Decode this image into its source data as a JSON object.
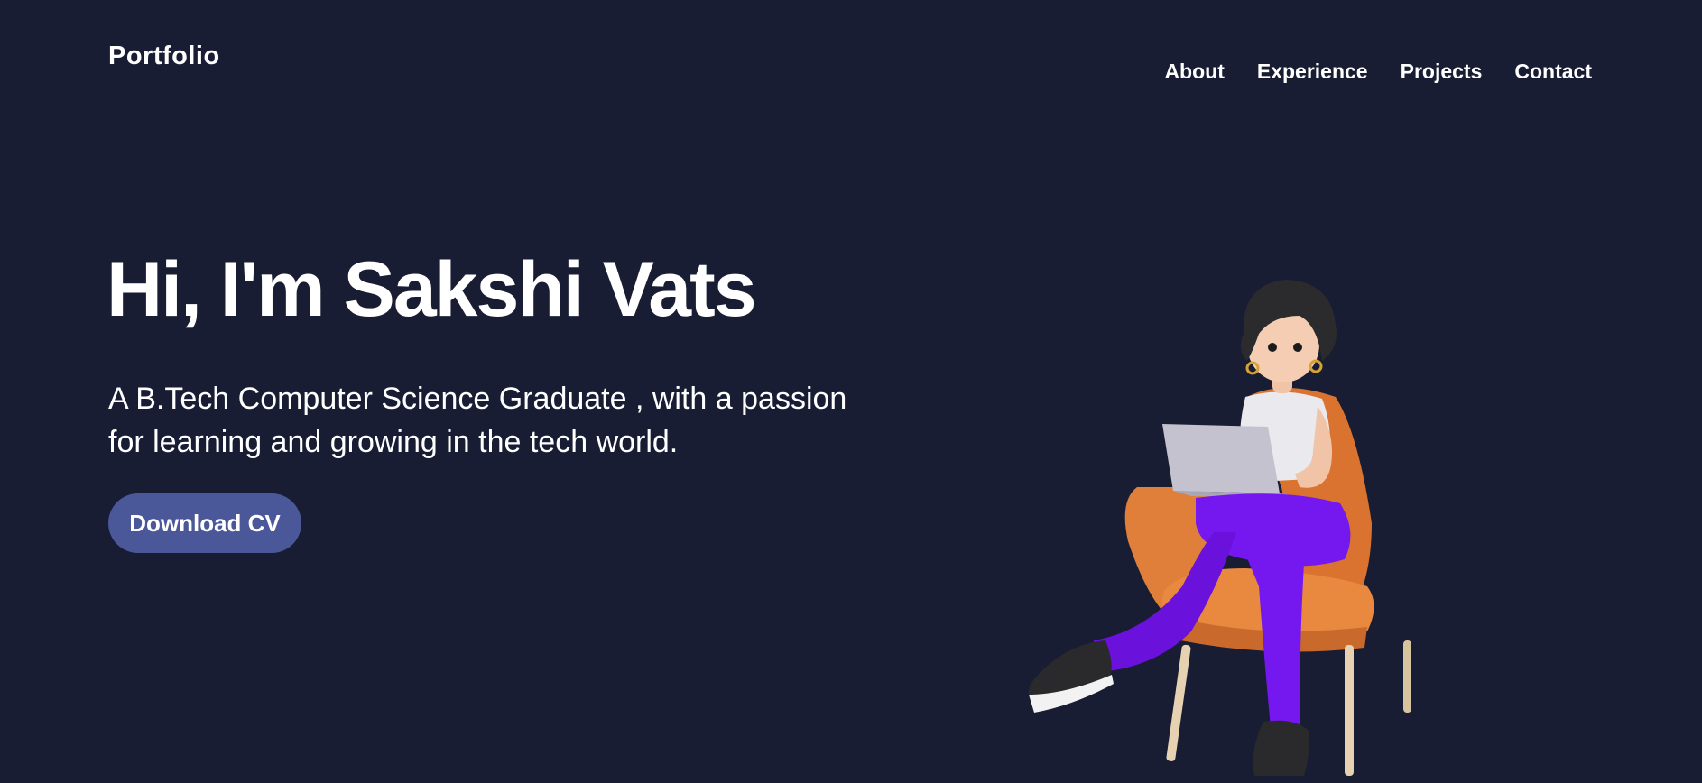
{
  "header": {
    "brand": "Portfolio",
    "nav": [
      {
        "label": "About"
      },
      {
        "label": "Experience"
      },
      {
        "label": "Projects"
      },
      {
        "label": "Contact"
      }
    ]
  },
  "hero": {
    "title": "Hi, I'm Sakshi Vats",
    "subtitle": "A B.Tech Computer Science Graduate , with a passion for learning and growing in the tech world.",
    "cta_label": "Download CV",
    "illustration": "woman-with-laptop-in-armchair"
  },
  "colors": {
    "background": "#181d33",
    "text": "#ffffff",
    "button": "#4a5899",
    "chair": "#e07f3a",
    "pants": "#7518f0"
  }
}
